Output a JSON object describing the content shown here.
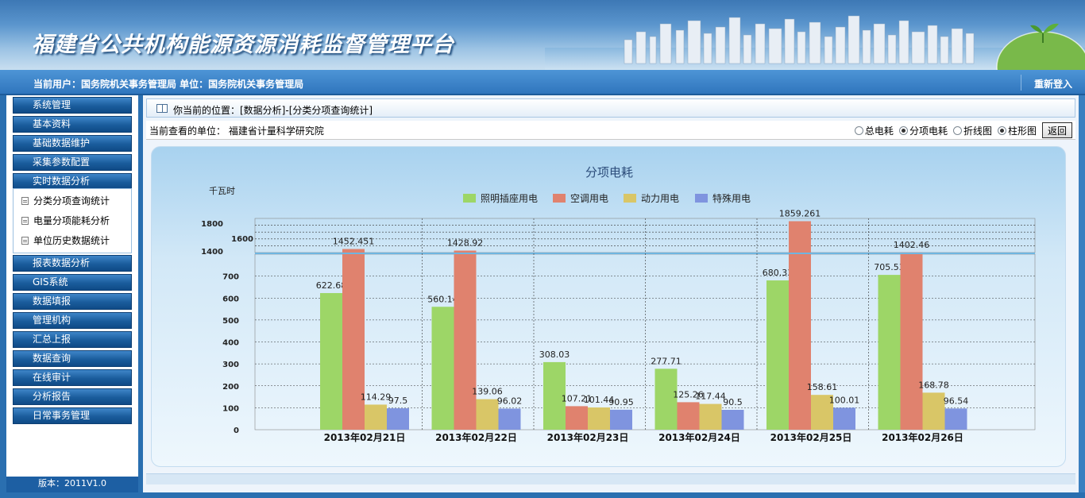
{
  "header": {
    "title": "福建省公共机构能源资源消耗监督管理平台",
    "current_user_text": "当前用户：国务院机关事务管理局  单位：国务院机关事务管理局",
    "relogin": "重新登入"
  },
  "sidebar": {
    "items_top": [
      "系统管理",
      "基本资料",
      "基础数据维护",
      "采集参数配置",
      "实时数据分析"
    ],
    "subitems": [
      "分类分项查询统计",
      "电量分项能耗分析",
      "单位历史数据统计"
    ],
    "items_bottom": [
      "报表数据分析",
      "GIS系统",
      "数据填报",
      "管理机构",
      "汇总上报",
      "数据查询",
      "在线审计",
      "分析报告",
      "日常事务管理"
    ],
    "version": "版本：2011V1.0"
  },
  "breadcrumb": "你当前的位置：[数据分析]-[分类分项查询统计]",
  "toolbar": {
    "unit_label": "当前查看的单位： 福建省计量科学研究院",
    "options": [
      {
        "label": "总电耗",
        "checked": false
      },
      {
        "label": "分项电耗",
        "checked": true
      },
      {
        "label": "折线图",
        "checked": false
      },
      {
        "label": "柱形图",
        "checked": true
      }
    ],
    "back": "返回"
  },
  "colors": {
    "lighting": "#9dd667",
    "ac": "#e0826e",
    "power": "#d9c667",
    "special": "#7f94df"
  },
  "chart_data": {
    "type": "bar",
    "title": "分项电耗",
    "ylabel": "千瓦时",
    "categories": [
      "2013年02月21日",
      "2013年02月22日",
      "2013年02月23日",
      "2013年02月24日",
      "2013年02月25日",
      "2013年02月26日"
    ],
    "series": [
      {
        "name": "照明插座用电",
        "values": [
          622.68,
          560.14,
          308.03,
          277.71,
          680.33,
          705.53
        ]
      },
      {
        "name": "空调用电",
        "values": [
          1452.451,
          1428.92,
          107.21,
          125.26,
          1859.261,
          1402.46
        ]
      },
      {
        "name": "动力用电",
        "values": [
          114.29,
          139.06,
          101.44,
          117.44,
          158.61,
          168.78
        ]
      },
      {
        "name": "特殊用电",
        "values": [
          97.5,
          96.02,
          90.95,
          90.5,
          100.01,
          96.54
        ]
      }
    ],
    "value_labels": [
      [
        "622.68",
        "1452.451",
        "114.29",
        "97.5"
      ],
      [
        "560.14",
        "1428.92",
        "139.06",
        "96.02"
      ],
      [
        "308.03",
        "107.21",
        "101.44",
        "90.95"
      ],
      [
        "277.71",
        "125.26",
        "117.44",
        "90.5"
      ],
      [
        "680.33",
        "1859.261",
        "158.61",
        "100.01"
      ],
      [
        "705.53",
        "1402.46",
        "168.78",
        "96.54"
      ]
    ],
    "y_ticks_lower": [
      "0",
      "100",
      "200",
      "300",
      "400",
      "500",
      "600",
      "700"
    ],
    "y_ticks_upper": [
      "1400",
      "1600",
      "1800"
    ],
    "axis_break": true,
    "ylim": [
      0,
      1900
    ],
    "legend_position": "top-center",
    "grid": true
  }
}
